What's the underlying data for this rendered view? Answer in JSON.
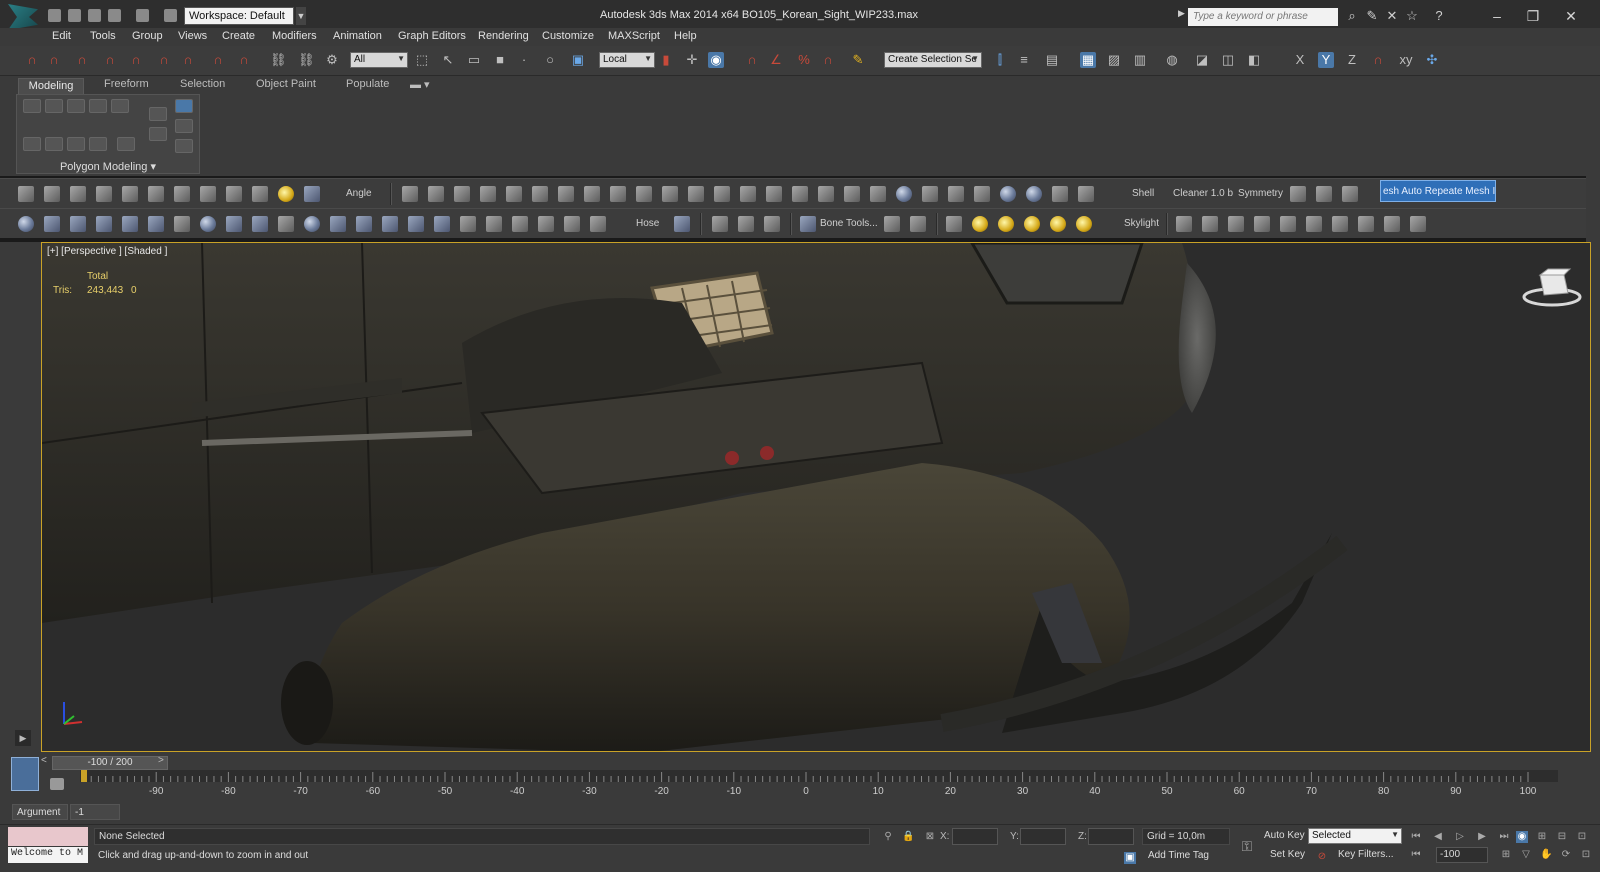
{
  "titlebar": {
    "workspace": "Workspace: Default",
    "window_title": "Autodesk 3ds Max  2014 x64     BO105_Korean_Sight_WIP233.max",
    "search_placeholder": "Type a keyword or phrase"
  },
  "menu": [
    "Edit",
    "Tools",
    "Group",
    "Views",
    "Create",
    "Modifiers",
    "Animation",
    "Graph Editors",
    "Rendering",
    "Customize",
    "MAXScript",
    "Help"
  ],
  "main_toolbar": {
    "selection_filter": "All",
    "reference_coord": "Local",
    "named_selection": "Create Selection Se"
  },
  "ribbon": {
    "tabs": [
      "Modeling",
      "Freeform",
      "Selection",
      "Object Paint",
      "Populate"
    ],
    "group_label": "Polygon Modeling"
  },
  "extra_toolbar_1": {
    "angle": "Angle",
    "shell": "Shell",
    "cleaner": "Cleaner 1.0 b",
    "symmetry": "Symmetry",
    "mesh_insp": "esh Auto Repeate Mesh Insp"
  },
  "extra_toolbar_2": {
    "hose": "Hose",
    "bone_tools": "Bone Tools...",
    "skylight": "Skylight"
  },
  "viewport": {
    "label": "[+] [Perspective ] [Shaded ]",
    "stats_total": "Total",
    "stats_tris_label": "Tris:",
    "stats_tris_value": "243,443",
    "stats_tris_selected": "0"
  },
  "time_slider": {
    "position": "-100 / 200",
    "ticks": [
      "-90",
      "-80",
      "-70",
      "-60",
      "-50",
      "-40",
      "-30",
      "-20",
      "-10",
      "0",
      "10",
      "20",
      "30",
      "40",
      "50",
      "60",
      "70",
      "80",
      "90",
      "100"
    ]
  },
  "argument": {
    "label": "Argument",
    "value": "-1"
  },
  "status": {
    "listener_text": "Welcome to M",
    "selection": "None Selected",
    "prompt": "Click and drag up-and-down to zoom in and out",
    "x_label": "X:",
    "y_label": "Y:",
    "z_label": "Z:",
    "grid": "Grid = 10,0m",
    "add_time_tag": "Add Time Tag",
    "auto_key": "Auto Key",
    "set_key": "Set Key",
    "key_mode": "Selected",
    "key_filters": "Key Filters...",
    "frame": "-100"
  },
  "colors": {
    "viewport_border": "#c9a227",
    "accent_blue": "#2f6fb8",
    "stats_text": "#e8d06a"
  }
}
